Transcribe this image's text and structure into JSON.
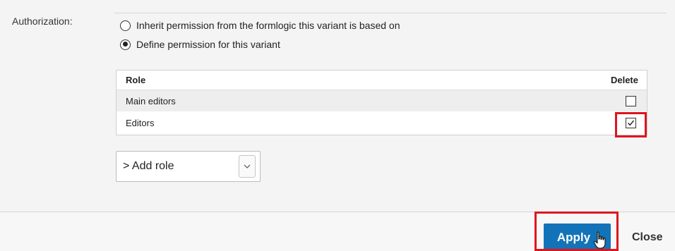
{
  "authorization": {
    "label": "Authorization:",
    "options": [
      {
        "label": "Inherit permission from the formlogic this variant is based on",
        "selected": false
      },
      {
        "label": "Define permission for this variant",
        "selected": true
      }
    ]
  },
  "roles_table": {
    "headers": {
      "role": "Role",
      "delete": "Delete"
    },
    "rows": [
      {
        "role": "Main editors",
        "delete_checked": false
      },
      {
        "role": "Editors",
        "delete_checked": true
      }
    ]
  },
  "add_role": {
    "selected": "> Add role"
  },
  "footer": {
    "apply_label": "Apply",
    "close_label": "Close"
  },
  "colors": {
    "primary_button": "#1273b8",
    "highlight": "#e0141e"
  },
  "icons": {
    "dropdown": "chevron-down-icon",
    "cursor": "hand-pointer-icon",
    "check": "check-icon"
  }
}
